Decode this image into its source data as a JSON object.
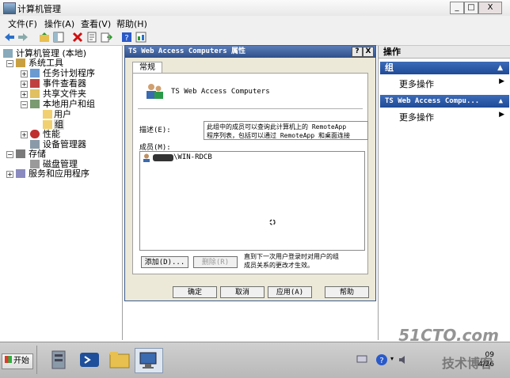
{
  "window": {
    "title": "计算机管理",
    "controls": {
      "minimize": "_",
      "maximize": "□",
      "close": "X"
    }
  },
  "menubar": [
    "文件(F)",
    "操作(A)",
    "查看(V)",
    "帮助(H)"
  ],
  "tree": {
    "root": "计算机管理 (本地)",
    "system_tools": "系统工具",
    "task_scheduler": "任务计划程序",
    "event_viewer": "事件查看器",
    "shared_folders": "共享文件夹",
    "local_users_groups": "本地用户和组",
    "users": "用户",
    "groups": "组",
    "performance": "性能",
    "device_manager": "设备管理器",
    "storage": "存储",
    "disk_management": "磁盘管理",
    "services_apps": "服务和应用程序"
  },
  "actions": {
    "header": "操作",
    "section1": "组",
    "more1": "更多操作",
    "section2": "TS Web Access Compu...",
    "more2": "更多操作"
  },
  "dialog": {
    "title": "TS Web Access Computers 属性",
    "help_btn": "?",
    "close_btn": "X",
    "tab": "常规",
    "group_name": "TS Web Access Computers",
    "desc_label": "描述(E):",
    "desc_line1": "此组中的成员可以查询此计算机上的 RemoteApp",
    "desc_line2": "程序列表，包括可以通过 RemoteApp 和桌面连接",
    "members_label": "成员(M):",
    "member1": "\\WIN-RDCB",
    "add": "添加(D)...",
    "remove": "删除(R)",
    "note_line1": "直到下一次用户登录时对用户的组",
    "note_line2": "成员关系的更改才生效。",
    "ok": "确定",
    "cancel": "取消",
    "apply": "应用(A)",
    "help": "帮助"
  },
  "taskbar": {
    "start": "开始",
    "clock_time": "09",
    "clock_date": "4/26"
  },
  "watermark": {
    "line1": "51CTO.com",
    "line2": "技术博客"
  }
}
